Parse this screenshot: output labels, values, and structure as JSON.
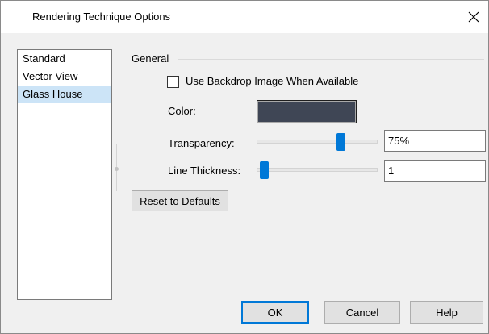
{
  "dialog": {
    "title": "Rendering Technique Options"
  },
  "nav": {
    "items": [
      {
        "label": "Standard"
      },
      {
        "label": "Vector View"
      },
      {
        "label": "Glass House"
      }
    ],
    "selected": "Glass House"
  },
  "general": {
    "group_label": "General",
    "backdrop_checkbox": {
      "label": "Use Backdrop Image When Available",
      "checked": false
    },
    "color": {
      "label": "Color:",
      "value": "#3f4655"
    },
    "transparency": {
      "label": "Transparency:",
      "value": "75%",
      "slider_fraction": 0.72
    },
    "line_thickness": {
      "label": "Line Thickness:",
      "value": "1",
      "slider_fraction": 0.03
    }
  },
  "buttons": {
    "reset": "Reset to Defaults",
    "ok": "OK",
    "cancel": "Cancel",
    "help": "Help"
  },
  "colors": {
    "accent": "#0078d7",
    "selection": "#cce4f7"
  }
}
